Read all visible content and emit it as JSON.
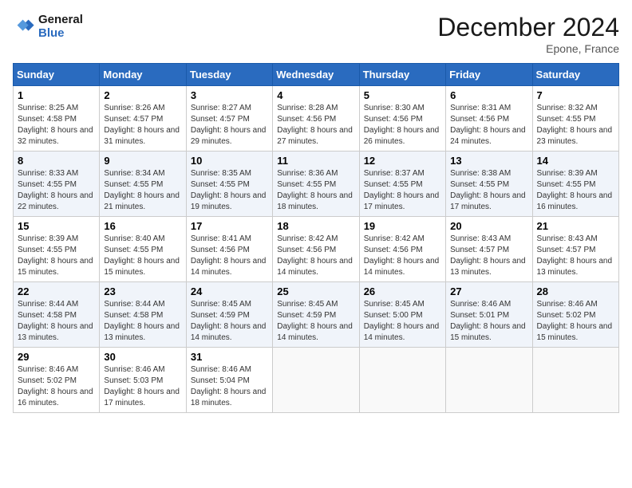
{
  "logo": {
    "line1": "General",
    "line2": "Blue"
  },
  "title": "December 2024",
  "location": "Epone, France",
  "days_of_week": [
    "Sunday",
    "Monday",
    "Tuesday",
    "Wednesday",
    "Thursday",
    "Friday",
    "Saturday"
  ],
  "weeks": [
    [
      {
        "day": "1",
        "sunrise": "8:25 AM",
        "sunset": "4:58 PM",
        "daylight": "8 hours and 32 minutes."
      },
      {
        "day": "2",
        "sunrise": "8:26 AM",
        "sunset": "4:57 PM",
        "daylight": "8 hours and 31 minutes."
      },
      {
        "day": "3",
        "sunrise": "8:27 AM",
        "sunset": "4:57 PM",
        "daylight": "8 hours and 29 minutes."
      },
      {
        "day": "4",
        "sunrise": "8:28 AM",
        "sunset": "4:56 PM",
        "daylight": "8 hours and 27 minutes."
      },
      {
        "day": "5",
        "sunrise": "8:30 AM",
        "sunset": "4:56 PM",
        "daylight": "8 hours and 26 minutes."
      },
      {
        "day": "6",
        "sunrise": "8:31 AM",
        "sunset": "4:56 PM",
        "daylight": "8 hours and 24 minutes."
      },
      {
        "day": "7",
        "sunrise": "8:32 AM",
        "sunset": "4:55 PM",
        "daylight": "8 hours and 23 minutes."
      }
    ],
    [
      {
        "day": "8",
        "sunrise": "8:33 AM",
        "sunset": "4:55 PM",
        "daylight": "8 hours and 22 minutes."
      },
      {
        "day": "9",
        "sunrise": "8:34 AM",
        "sunset": "4:55 PM",
        "daylight": "8 hours and 21 minutes."
      },
      {
        "day": "10",
        "sunrise": "8:35 AM",
        "sunset": "4:55 PM",
        "daylight": "8 hours and 19 minutes."
      },
      {
        "day": "11",
        "sunrise": "8:36 AM",
        "sunset": "4:55 PM",
        "daylight": "8 hours and 18 minutes."
      },
      {
        "day": "12",
        "sunrise": "8:37 AM",
        "sunset": "4:55 PM",
        "daylight": "8 hours and 17 minutes."
      },
      {
        "day": "13",
        "sunrise": "8:38 AM",
        "sunset": "4:55 PM",
        "daylight": "8 hours and 17 minutes."
      },
      {
        "day": "14",
        "sunrise": "8:39 AM",
        "sunset": "4:55 PM",
        "daylight": "8 hours and 16 minutes."
      }
    ],
    [
      {
        "day": "15",
        "sunrise": "8:39 AM",
        "sunset": "4:55 PM",
        "daylight": "8 hours and 15 minutes."
      },
      {
        "day": "16",
        "sunrise": "8:40 AM",
        "sunset": "4:55 PM",
        "daylight": "8 hours and 15 minutes."
      },
      {
        "day": "17",
        "sunrise": "8:41 AM",
        "sunset": "4:56 PM",
        "daylight": "8 hours and 14 minutes."
      },
      {
        "day": "18",
        "sunrise": "8:42 AM",
        "sunset": "4:56 PM",
        "daylight": "8 hours and 14 minutes."
      },
      {
        "day": "19",
        "sunrise": "8:42 AM",
        "sunset": "4:56 PM",
        "daylight": "8 hours and 14 minutes."
      },
      {
        "day": "20",
        "sunrise": "8:43 AM",
        "sunset": "4:57 PM",
        "daylight": "8 hours and 13 minutes."
      },
      {
        "day": "21",
        "sunrise": "8:43 AM",
        "sunset": "4:57 PM",
        "daylight": "8 hours and 13 minutes."
      }
    ],
    [
      {
        "day": "22",
        "sunrise": "8:44 AM",
        "sunset": "4:58 PM",
        "daylight": "8 hours and 13 minutes."
      },
      {
        "day": "23",
        "sunrise": "8:44 AM",
        "sunset": "4:58 PM",
        "daylight": "8 hours and 13 minutes."
      },
      {
        "day": "24",
        "sunrise": "8:45 AM",
        "sunset": "4:59 PM",
        "daylight": "8 hours and 14 minutes."
      },
      {
        "day": "25",
        "sunrise": "8:45 AM",
        "sunset": "4:59 PM",
        "daylight": "8 hours and 14 minutes."
      },
      {
        "day": "26",
        "sunrise": "8:45 AM",
        "sunset": "5:00 PM",
        "daylight": "8 hours and 14 minutes."
      },
      {
        "day": "27",
        "sunrise": "8:46 AM",
        "sunset": "5:01 PM",
        "daylight": "8 hours and 15 minutes."
      },
      {
        "day": "28",
        "sunrise": "8:46 AM",
        "sunset": "5:02 PM",
        "daylight": "8 hours and 15 minutes."
      }
    ],
    [
      {
        "day": "29",
        "sunrise": "8:46 AM",
        "sunset": "5:02 PM",
        "daylight": "8 hours and 16 minutes."
      },
      {
        "day": "30",
        "sunrise": "8:46 AM",
        "sunset": "5:03 PM",
        "daylight": "8 hours and 17 minutes."
      },
      {
        "day": "31",
        "sunrise": "8:46 AM",
        "sunset": "5:04 PM",
        "daylight": "8 hours and 18 minutes."
      },
      null,
      null,
      null,
      null
    ]
  ],
  "labels": {
    "sunrise": "Sunrise:",
    "sunset": "Sunset:",
    "daylight": "Daylight:"
  }
}
